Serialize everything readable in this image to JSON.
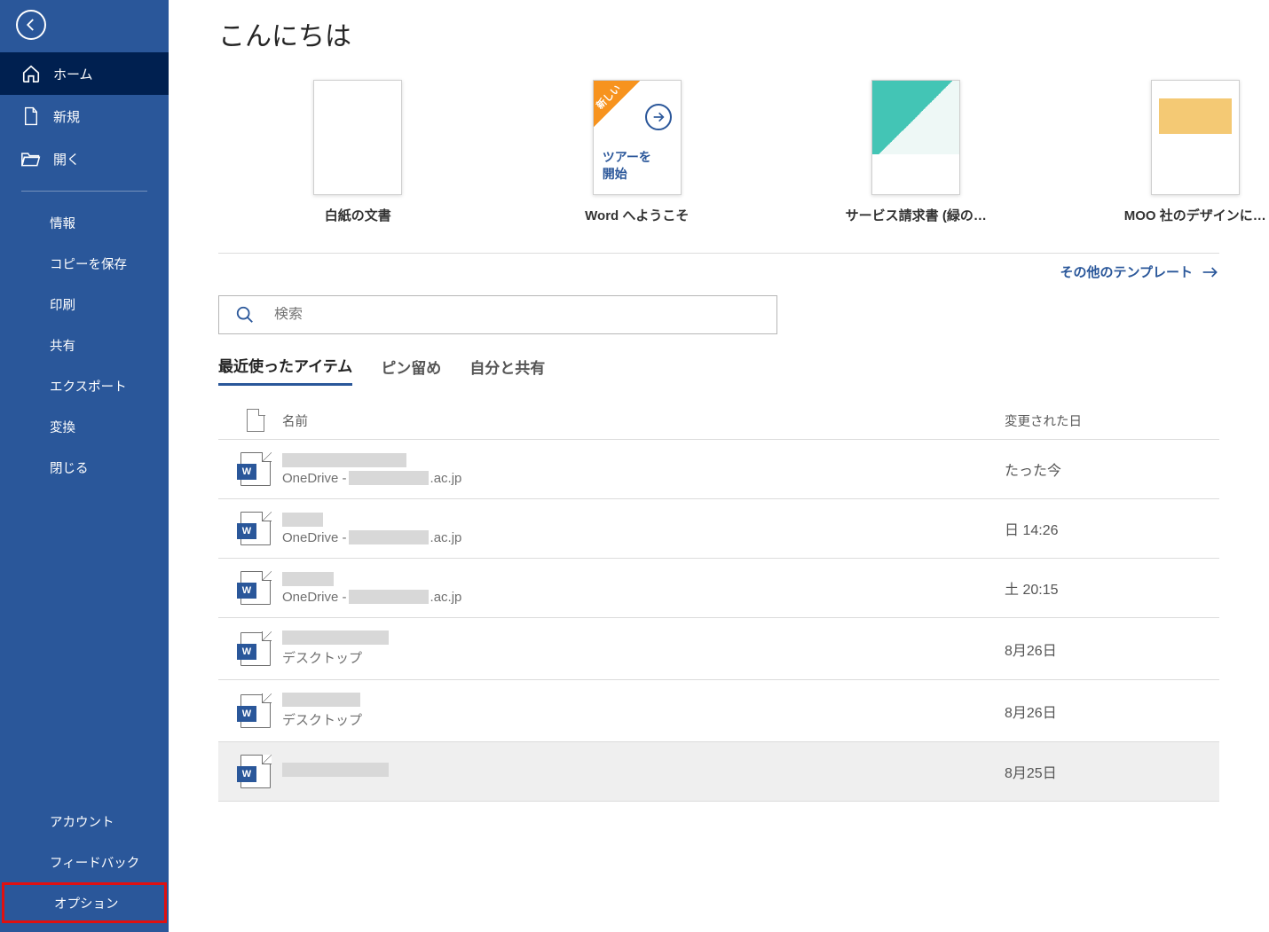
{
  "greeting": "こんにちは",
  "sidebar": {
    "primary": [
      {
        "label": "ホーム",
        "icon": "home"
      },
      {
        "label": "新規",
        "icon": "new"
      },
      {
        "label": "開く",
        "icon": "open"
      }
    ],
    "secondary": [
      {
        "label": "情報"
      },
      {
        "label": "コピーを保存"
      },
      {
        "label": "印刷"
      },
      {
        "label": "共有"
      },
      {
        "label": "エクスポート"
      },
      {
        "label": "変換"
      },
      {
        "label": "閉じる"
      }
    ],
    "bottom": [
      {
        "label": "アカウント"
      },
      {
        "label": "フィードバック"
      },
      {
        "label": "オプション"
      }
    ]
  },
  "templates": {
    "items": [
      {
        "label": "白紙の文書",
        "kind": "blank"
      },
      {
        "label": "Word へようこそ",
        "kind": "tour",
        "badge": "新しい",
        "tour_line1": "ツアーを",
        "tour_line2": "開始"
      },
      {
        "label": "サービス請求書 (緑の…",
        "kind": "invoice"
      },
      {
        "label": "MOO 社のデザインに…",
        "kind": "moo"
      }
    ],
    "more": "その他のテンプレート"
  },
  "search": {
    "placeholder": "検索"
  },
  "tabs": [
    {
      "label": "最近使ったアイテム",
      "active": true
    },
    {
      "label": "ピン留め"
    },
    {
      "label": "自分と共有"
    }
  ],
  "table": {
    "head_name": "名前",
    "head_date": "変更された日"
  },
  "files": [
    {
      "name_width": 140,
      "path_prefix": "OneDrive - ",
      "path_suffix": ".ac.jp",
      "date": "たった今"
    },
    {
      "name_width": 46,
      "path_prefix": "OneDrive - ",
      "path_suffix": ".ac.jp",
      "date": "日 14:26"
    },
    {
      "name_width": 58,
      "path_prefix": "OneDrive - ",
      "path_suffix": ".ac.jp",
      "date": "土 20:15"
    },
    {
      "name_width": 120,
      "path": "デスクトップ",
      "date": "8月26日"
    },
    {
      "name_width": 88,
      "path": "デスクトップ",
      "date": "8月26日"
    },
    {
      "name_width": 120,
      "path": "",
      "date": "8月25日",
      "selected": true
    }
  ]
}
